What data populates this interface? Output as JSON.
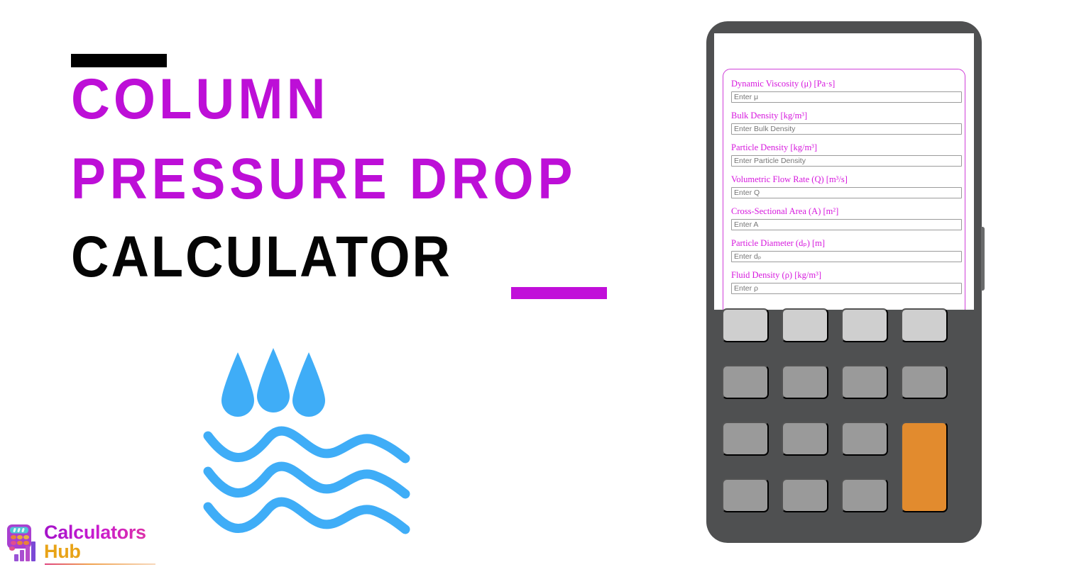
{
  "page": {
    "background": "#ffffff",
    "accent_purple": "#bd0fd7",
    "accent_black": "#000000",
    "water_blue": "#3fadf7"
  },
  "hero": {
    "title_lines": [
      {
        "text": "COLUMN",
        "color": "#bd0fd7"
      },
      {
        "text": "PRESSURE DROP",
        "color": "#bd0fd7"
      },
      {
        "text": "CALCULATOR",
        "color": "#050505"
      }
    ],
    "top_accent_bar_color": "#000000",
    "bottom_accent_bar_color": "#c10fd9",
    "illustration": {
      "name": "water-droplets-waves",
      "color": "#3fadf7",
      "droplets": 3,
      "waves": 3
    }
  },
  "logo": {
    "word_primary": "Calculators",
    "word_secondary": "Hub",
    "primary_color": "#c01ad4",
    "secondary_color": "#e8a317",
    "icon_name": "calculator-bars-icon"
  },
  "device": {
    "frame_color": "#4f5051",
    "screen_color": "#ffffff",
    "panel_border_color": "#cf3fd9",
    "form": {
      "fields": [
        {
          "label": "Dynamic Viscosity (μ) [Pa·s]",
          "placeholder": "Enter μ",
          "value": "",
          "name": "dynamic-viscosity"
        },
        {
          "label": "Bulk Density [kg/m³]",
          "placeholder": "Enter Bulk Density",
          "value": "",
          "name": "bulk-density"
        },
        {
          "label": "Particle Density [kg/m³]",
          "placeholder": "Enter Particle Density",
          "value": "",
          "name": "particle-density"
        },
        {
          "label": "Volumetric Flow Rate (Q) [m³/s]",
          "placeholder": "Enter Q",
          "value": "",
          "name": "volumetric-flow-rate"
        },
        {
          "label": "Cross-Sectional Area (A) [m²]",
          "placeholder": "Enter A",
          "value": "",
          "name": "cross-sectional-area"
        },
        {
          "label": "Particle Diameter (dₚ) [m]",
          "placeholder": "Enter dₚ",
          "value": "",
          "name": "particle-diameter"
        },
        {
          "label": "Fluid Density (ρ) [kg/m³]",
          "placeholder": "Enter ρ",
          "value": "",
          "name": "fluid-density"
        }
      ]
    },
    "keypad": {
      "rows": 4,
      "columns": 4,
      "light_key_color": "#cfcfcf",
      "key_color": "#9a9a9a",
      "accent_key_color": "#e28b2e",
      "keys": [
        {
          "label": "",
          "style": "light"
        },
        {
          "label": "",
          "style": "light"
        },
        {
          "label": "",
          "style": "light"
        },
        {
          "label": "",
          "style": "light"
        },
        {
          "label": "",
          "style": "normal"
        },
        {
          "label": "",
          "style": "normal"
        },
        {
          "label": "",
          "style": "normal"
        },
        {
          "label": "",
          "style": "normal"
        },
        {
          "label": "",
          "style": "normal"
        },
        {
          "label": "",
          "style": "normal"
        },
        {
          "label": "",
          "style": "normal"
        },
        {
          "label": "",
          "style": "accent-tall"
        },
        {
          "label": "",
          "style": "normal"
        },
        {
          "label": "",
          "style": "normal"
        },
        {
          "label": "",
          "style": "normal"
        }
      ]
    }
  }
}
